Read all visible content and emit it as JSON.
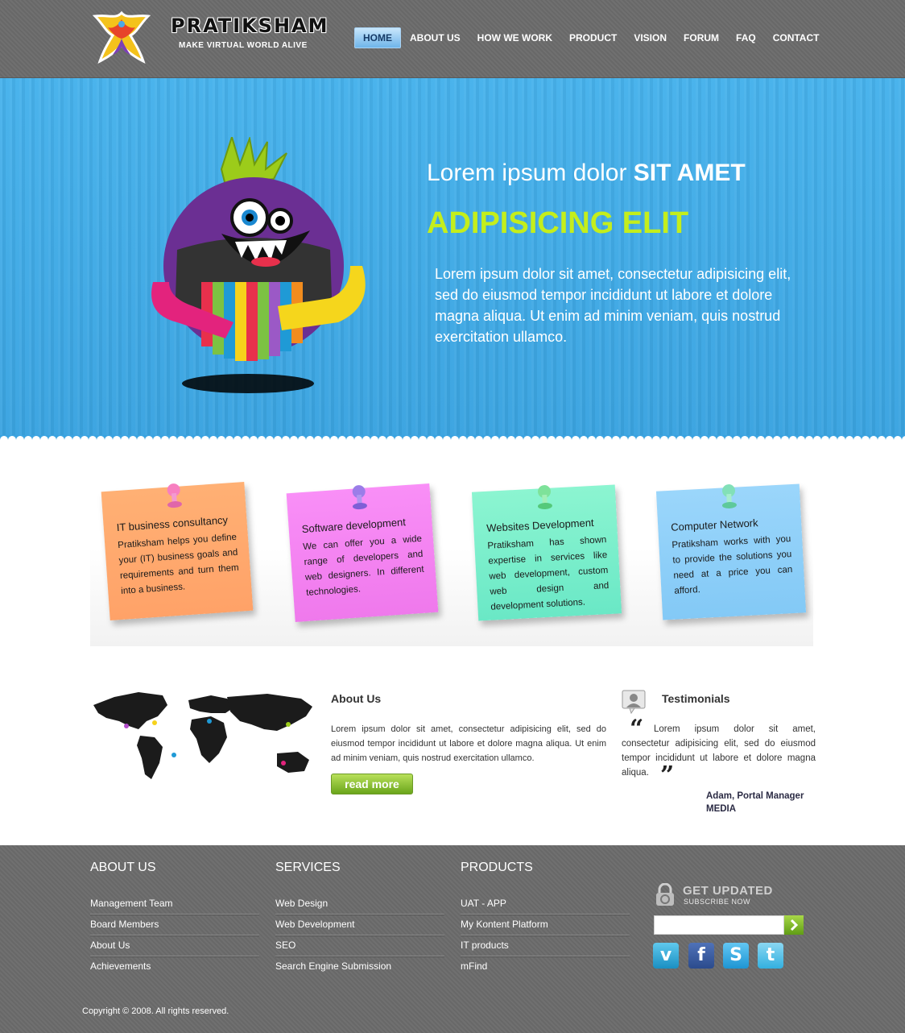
{
  "brand": {
    "name": "PRATIKSHAM",
    "tagline": "MAKE VIRTUAL WORLD ALIVE"
  },
  "nav": {
    "items": [
      {
        "label": "HOME",
        "active": true
      },
      {
        "label": "ABOUT US"
      },
      {
        "label": "HOW WE WORK"
      },
      {
        "label": "PRODUCT"
      },
      {
        "label": "VISION"
      },
      {
        "label": "FORUM"
      },
      {
        "label": "FAQ"
      },
      {
        "label": "CONTACT"
      }
    ]
  },
  "hero": {
    "headline_normal": "Lorem ipsum dolor ",
    "headline_bold": "SIT AMET",
    "subheadline": "ADIPISICING ELIT",
    "body": "Lorem ipsum dolor sit amet, consectetur adipisicing elit, sed do eiusmod tempor incididunt ut labore et dolore magna aliqua. Ut enim ad minim veniam, quis nostrud exercitation ullamco."
  },
  "services": [
    {
      "title": "IT business consultancy",
      "text": "Pratiksham helps you define your (IT) business goals and requirements and turn them into a business.",
      "color": "#ffa86c"
    },
    {
      "title": "Software development",
      "text": "We can offer you a wide range of developers and web designers. In different technologies.",
      "color": "#f585f2"
    },
    {
      "title": "Websites Development",
      "text": "Pratiksham has shown expertise in services like web development, custom web design and development solutions.",
      "color": "#7ef0cc"
    },
    {
      "title": "Computer Network",
      "text": "Pratiksham works with you to provide the solutions you need at a price you can afford.",
      "color": "#8fd0f8"
    }
  ],
  "about": {
    "title": "About Us",
    "text": "Lorem ipsum dolor sit amet, consectetur adipisicing elit, sed do eiusmod tempor incididunt ut labore et dolore magna aliqua. Ut enim ad minim veniam, quis nostrud exercitation ullamco.",
    "read_more": "read more"
  },
  "testimonials": {
    "title": "Testimonials",
    "quote": "Lorem ipsum dolor sit amet, consectetur adipisicing elit, sed do eiusmod tempor incididunt ut labore et dolore magna aliqua.",
    "author": "Adam, Portal Manager",
    "company": "MEDIA"
  },
  "footer": {
    "about": {
      "title": "ABOUT US",
      "links": [
        "Management Team",
        "Board Members",
        "About Us",
        "Achievements"
      ]
    },
    "services": {
      "title": "SERVICES",
      "links": [
        "Web Design",
        "Web Development",
        "SEO",
        "Search Engine Submission"
      ]
    },
    "products": {
      "title": "PRODUCTS",
      "links": [
        "UAT - APP",
        "My Kontent Platform",
        "IT products",
        "mFind"
      ]
    },
    "subscribe": {
      "title": "GET UPDATED",
      "subtitle": "SUBSCRIBE NOW",
      "placeholder": ""
    },
    "social": [
      {
        "name": "vimeo-icon",
        "glyph": "v"
      },
      {
        "name": "facebook-icon",
        "glyph": "f"
      },
      {
        "name": "skype-icon",
        "glyph": "S"
      },
      {
        "name": "twitter-icon",
        "glyph": "t"
      }
    ],
    "copyright": "Copyright © 2008. All rights reserved."
  },
  "colors": {
    "header_bg": "#6b6b6b",
    "hero_bg": "#3fa9e6",
    "accent_green": "#c4ee1c",
    "nav_active": "#6fb5ea"
  }
}
